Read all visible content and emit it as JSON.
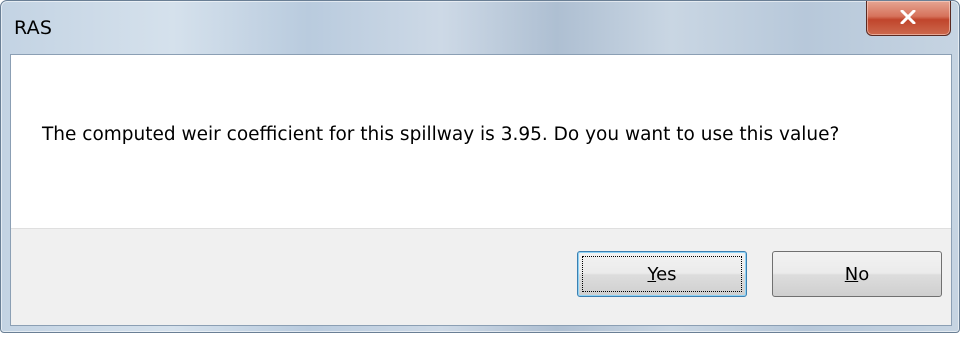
{
  "window": {
    "title": "RAS",
    "close_glyph": "x"
  },
  "message": {
    "text": "The computed weir coefficient for this spillway is 3.95.  Do you want to use this value?"
  },
  "buttons": {
    "yes": {
      "label_rest": "es",
      "mnemonic": "Y",
      "is_default": true
    },
    "no": {
      "label_rest": "o",
      "mnemonic": "N"
    }
  }
}
